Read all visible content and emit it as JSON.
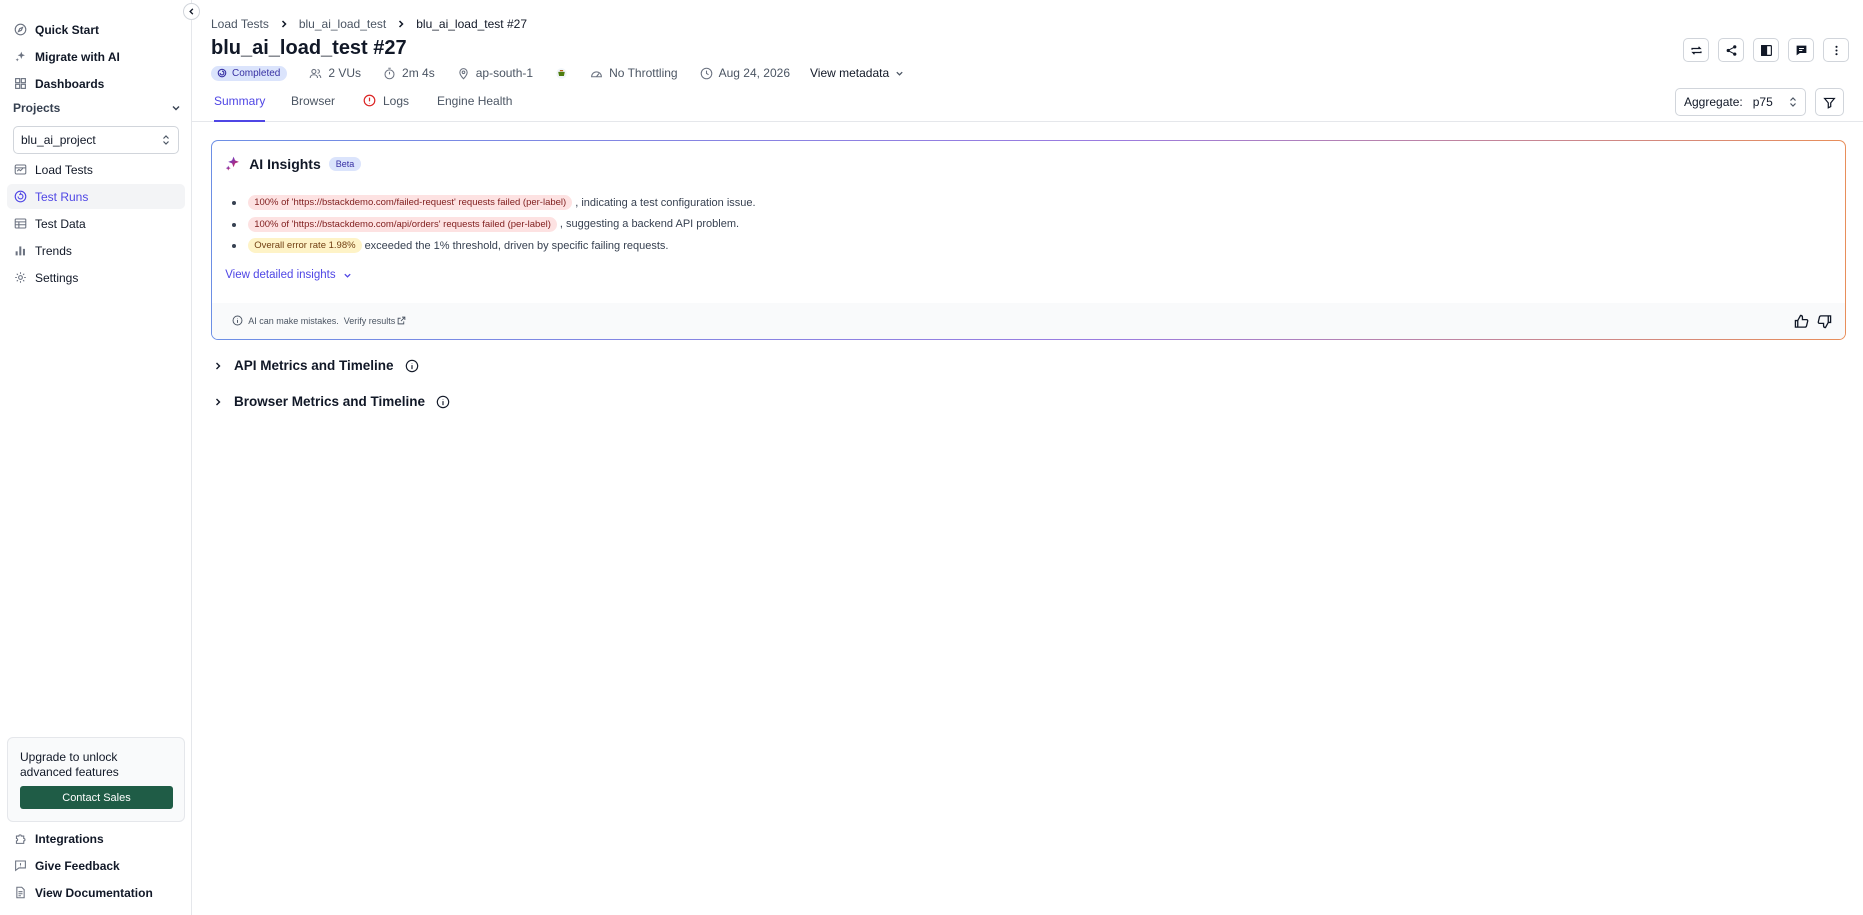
{
  "sidebar": {
    "top_items": [
      {
        "label": "Quick Start",
        "icon": "compass-icon"
      },
      {
        "label": "Migrate with AI",
        "icon": "sparkle-icon"
      },
      {
        "label": "Dashboards",
        "icon": "grid-icon"
      }
    ],
    "projects_label": "Projects",
    "project_selected": "blu_ai_project",
    "project_items": [
      {
        "label": "Load Tests",
        "icon": "load-tests-icon"
      },
      {
        "label": "Test Runs",
        "icon": "test-runs-icon",
        "active": true
      },
      {
        "label": "Test Data",
        "icon": "table-icon"
      },
      {
        "label": "Trends",
        "icon": "bar-chart-icon"
      },
      {
        "label": "Settings",
        "icon": "gear-icon"
      }
    ],
    "upgrade": {
      "text": "Upgrade to unlock advanced features",
      "button": "Contact Sales"
    },
    "bottom_items": [
      {
        "label": "Integrations",
        "icon": "puzzle-icon"
      },
      {
        "label": "Give Feedback",
        "icon": "feedback-icon"
      },
      {
        "label": "View Documentation",
        "icon": "document-icon"
      }
    ]
  },
  "header": {
    "breadcrumb": [
      "Load Tests",
      "blu_ai_load_test",
      "blu_ai_load_test #27"
    ],
    "title": "blu_ai_load_test #27",
    "status": "Completed",
    "vus": "2 VUs",
    "duration": "2m 4s",
    "region": "ap-south-1",
    "throttling": "No Throttling",
    "date": "Aug 24, 2026",
    "view_metadata": "View metadata",
    "actions": [
      "rerun-icon",
      "share-icon",
      "compare-icon",
      "comment-icon",
      "more-icon"
    ]
  },
  "tabs": [
    {
      "label": "Summary",
      "active": true
    },
    {
      "label": "Browser"
    },
    {
      "label": "Logs",
      "alert": true
    },
    {
      "label": "Engine Health"
    }
  ],
  "aggregate": {
    "label": "Aggregate:",
    "value": "p75"
  },
  "ai_insights": {
    "title": "AI Insights",
    "badge": "Beta",
    "items": [
      {
        "pill": "100% of 'https://bstackdemo.com/failed-request' requests failed (per-label)",
        "tone": "red",
        "text": ", indicating a test configuration issue."
      },
      {
        "pill": "100% of 'https://bstackdemo.com/api/orders' requests failed (per-label)",
        "tone": "red",
        "text": ", suggesting a backend API problem."
      },
      {
        "pill": "Overall error rate 1.98%",
        "tone": "yellow",
        "text": " exceeded the 1% threshold, driven by specific failing requests."
      }
    ],
    "detail_link": "View detailed insights",
    "disclaimer": "AI can make mistakes.",
    "verify": "Verify results"
  },
  "sections": [
    {
      "title": "API Metrics and Timeline"
    },
    {
      "title": "Browser Metrics and Timeline"
    }
  ],
  "colors": {
    "accent": "#4f46e5",
    "sales_button": "#1f5c46",
    "status_bg": "#dbe4fc",
    "error_pill": "#fde2e2",
    "warning_pill": "#fef3c7"
  }
}
